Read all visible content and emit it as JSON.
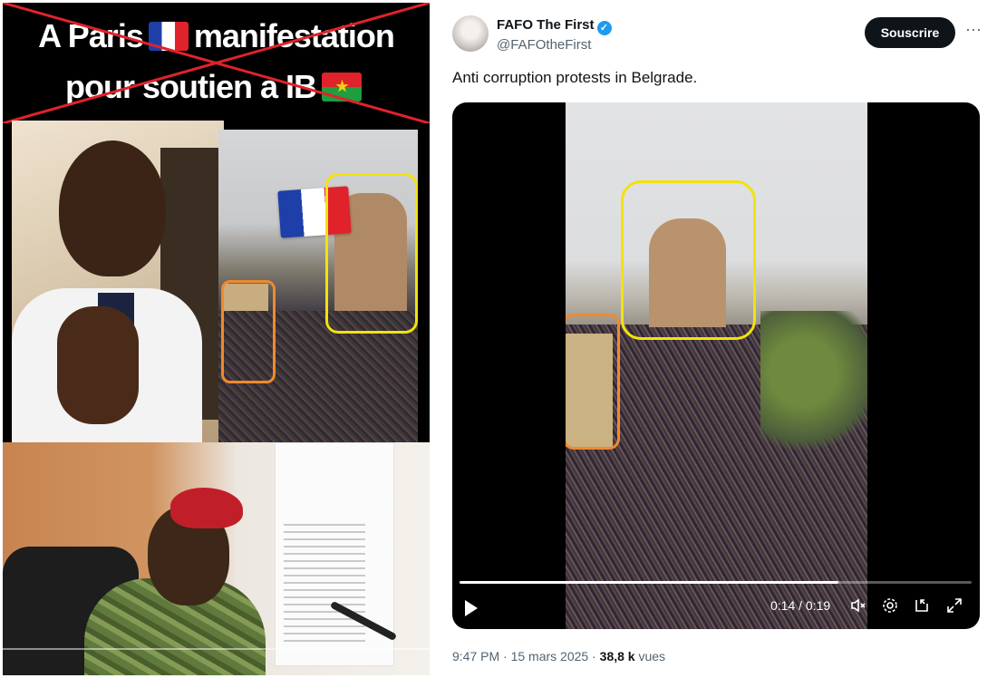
{
  "left_post": {
    "banner_line1_pre": "A Paris",
    "banner_line1_post": "manifestation",
    "banner_line2": "pour soutien a IB",
    "flag_left": "france-flag",
    "flag_right": "burkina-faso-flag",
    "crossed_out": true
  },
  "tweet": {
    "author_name": "FAFO The First",
    "author_handle": "@FAFOtheFirst",
    "verified": true,
    "subscribe_label": "Souscrire",
    "more_label": "···",
    "text": "Anti corruption protests in Belgrade.",
    "video": {
      "time": "0:14 / 0:19",
      "progress": 0.74,
      "icons": [
        "play-icon",
        "volume-muted-icon",
        "settings-icon",
        "picture-in-picture-icon",
        "fullscreen-icon"
      ]
    },
    "meta_time": "9:47 PM",
    "meta_sep": "·",
    "meta_date": "15 mars 2025",
    "meta_views": "38,8 k",
    "meta_views_label": "vues"
  },
  "colors": {
    "highlight_yellow": "#f2e20f",
    "highlight_orange": "#f08a2c",
    "cross_red": "#e0222b",
    "verified_blue": "#1d9bf0"
  }
}
